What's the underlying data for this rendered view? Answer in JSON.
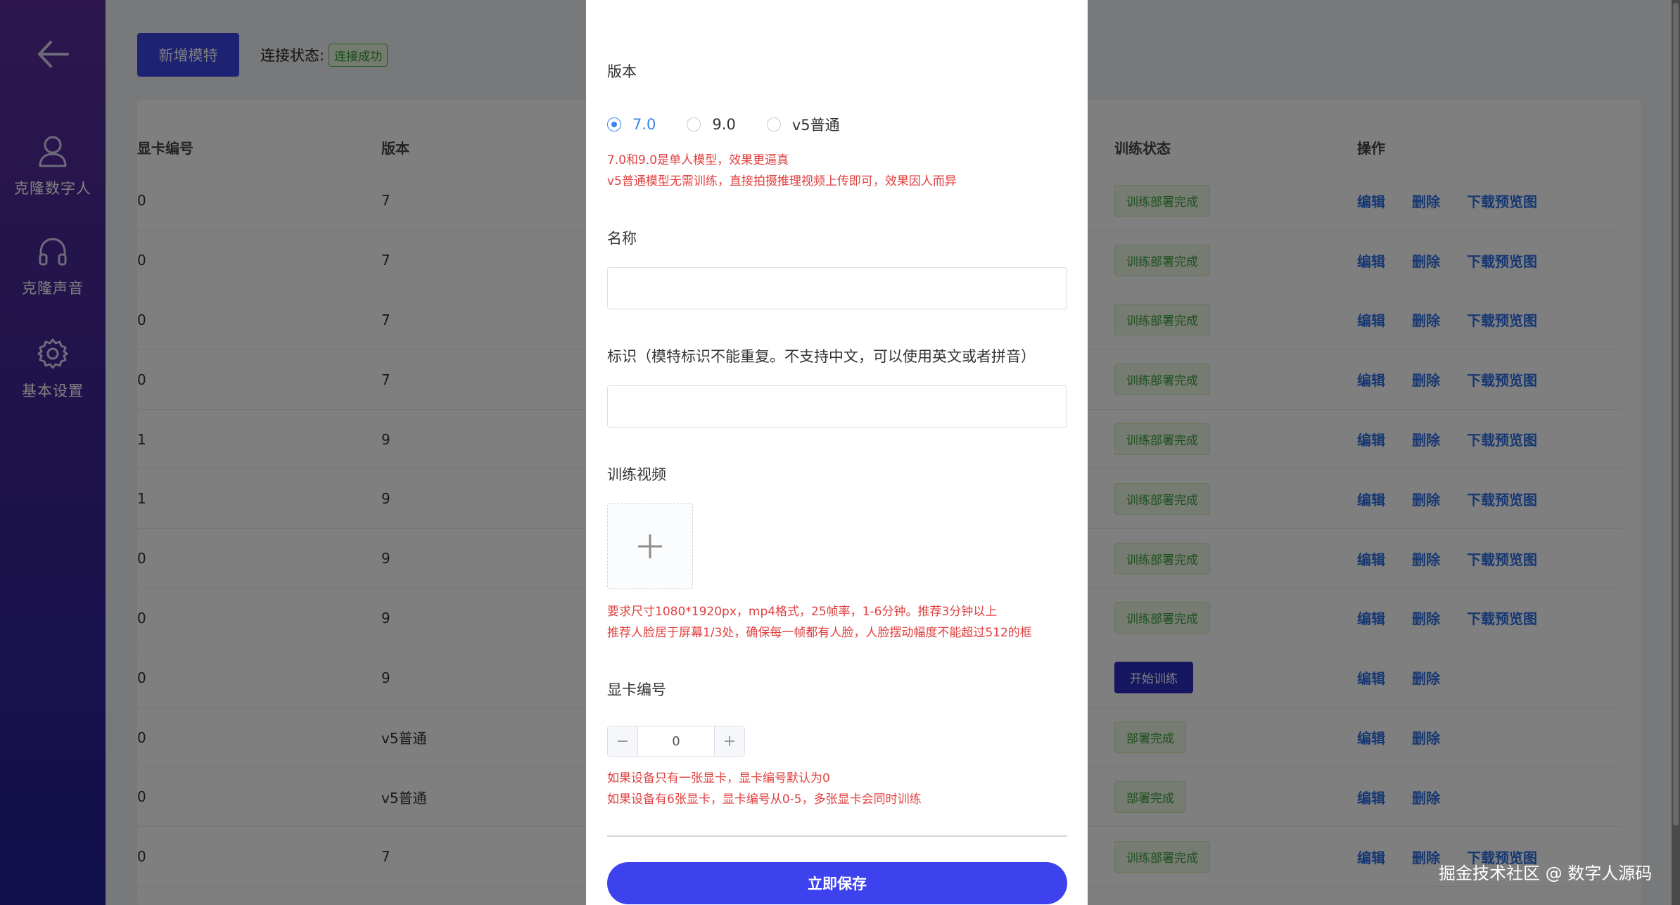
{
  "sidebar": {
    "items": [
      {
        "label": "克隆数字人",
        "icon": "user-icon"
      },
      {
        "label": "克隆声音",
        "icon": "headphones-icon"
      },
      {
        "label": "基本设置",
        "icon": "gear-icon"
      }
    ]
  },
  "toolbar": {
    "add_label": "新增模特",
    "connection_label": "连接状态:",
    "connection_status": "连接成功"
  },
  "table": {
    "columns": {
      "gpu": "显卡编号",
      "version": "版本",
      "status": "训练状态",
      "ops": "操作"
    },
    "ops_labels": {
      "edit": "编辑",
      "delete": "删除",
      "download": "下载预览图"
    },
    "rows": [
      {
        "gpu": "0",
        "version": "7",
        "status": "训练部署完成",
        "status_type": "tag",
        "download": true
      },
      {
        "gpu": "0",
        "version": "7",
        "status": "训练部署完成",
        "status_type": "tag",
        "download": true
      },
      {
        "gpu": "0",
        "version": "7",
        "status": "训练部署完成",
        "status_type": "tag",
        "download": true
      },
      {
        "gpu": "0",
        "version": "7",
        "status": "训练部署完成",
        "status_type": "tag",
        "download": true
      },
      {
        "gpu": "1",
        "version": "9",
        "status": "训练部署完成",
        "status_type": "tag",
        "download": true
      },
      {
        "gpu": "1",
        "version": "9",
        "status": "训练部署完成",
        "status_type": "tag",
        "download": true
      },
      {
        "gpu": "0",
        "version": "9",
        "status": "训练部署完成",
        "status_type": "tag",
        "download": true
      },
      {
        "gpu": "0",
        "version": "9",
        "status": "训练部署完成",
        "status_type": "tag",
        "download": true
      },
      {
        "gpu": "0",
        "version": "9",
        "status": "开始训练",
        "status_type": "button",
        "download": false
      },
      {
        "gpu": "0",
        "version": "v5普通",
        "status": "部署完成",
        "status_type": "tag",
        "download": false
      },
      {
        "gpu": "0",
        "version": "v5普通",
        "status": "部署完成",
        "status_type": "tag",
        "download": false
      },
      {
        "gpu": "0",
        "version": "7",
        "status": "训练部署完成",
        "status_type": "tag",
        "download": true
      }
    ]
  },
  "modal": {
    "version_label": "版本",
    "version_options": [
      {
        "label": "7.0",
        "checked": true
      },
      {
        "label": "9.0",
        "checked": false
      },
      {
        "label": "v5普通",
        "checked": false
      }
    ],
    "version_hint_1": "7.0和9.0是单人模型，效果更逼真",
    "version_hint_2": "v5普通模型无需训练，直接拍摄推理视频上传即可，效果因人而异",
    "name_label": "名称",
    "name_value": "",
    "id_label": "标识（模特标识不能重复。不支持中文，可以使用英文或者拼音）",
    "id_value": "",
    "video_label": "训练视频",
    "video_hint_1": "要求尺寸1080*1920px，mp4格式，25帧率，1-6分钟。推荐3分钟以上",
    "video_hint_2": "推荐人脸居于屏幕1/3处，确保每一帧都有人脸，人脸摆动幅度不能超过512的框",
    "gpu_label": "显卡编号",
    "gpu_value": "0",
    "gpu_hint_1": "如果设备只有一张显卡，显卡编号默认为0",
    "gpu_hint_2": "如果设备有6张显卡，显卡编号从0-5，多张显卡会同时训练",
    "save_label": "立即保存"
  },
  "watermark": "掘金技术社区 @ 数字人源码"
}
